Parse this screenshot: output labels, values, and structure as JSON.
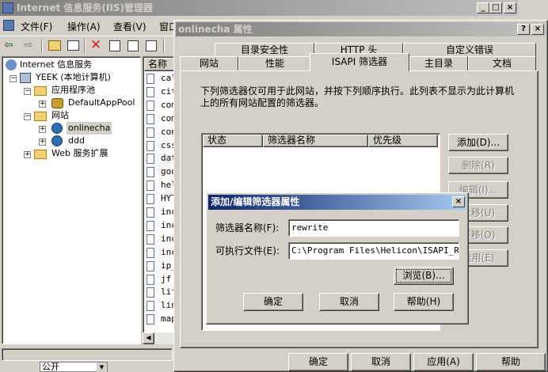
{
  "main_window": {
    "title": "Internet 信息服务(IIS)管理器",
    "menu": [
      "文件(F)",
      "操作(A)",
      "查看(V)",
      "窗口(W)"
    ],
    "tree": [
      {
        "label": "Internet 信息服务"
      },
      {
        "label": "YEEK (本地计算机)"
      },
      {
        "label": "应用程序池"
      },
      {
        "label": "DefaultAppPool"
      },
      {
        "label": "网站"
      },
      {
        "label": "onlinecha"
      },
      {
        "label": "ddd"
      },
      {
        "label": "Web 服务扩展"
      }
    ],
    "list_header": "名称",
    "files": [
      "cal",
      "cit",
      "com",
      "com",
      "con",
      "css",
      "dat",
      "goo",
      "hel",
      "HYT",
      "inc",
      "inc",
      "inc",
      "inc",
      "ip_",
      "jf.",
      "lif",
      "lin",
      "map"
    ],
    "status_text": "公开"
  },
  "properties_dialog": {
    "title": "onlinecha 属性",
    "tabs_row1": [
      "目录安全性",
      "HTTP 头",
      "自定义错误"
    ],
    "tabs_row2": [
      "网站",
      "性能",
      "ISAPI 筛选器",
      "主目录",
      "文档"
    ],
    "description": "下列筛选器仅可用于此网站，并按下列顺序执行。此列表不显示为此计算机上的所有网站配置的筛选器。",
    "columns": [
      "状态",
      "筛选器名称",
      "优先级"
    ],
    "side_buttons": [
      "添加(D)...",
      "删除(R)",
      "编辑(I)...",
      "上移(U)",
      "下移(O)",
      "启用(E)"
    ],
    "bottom_buttons": {
      "ok": "确定",
      "cancel": "取消",
      "apply": "应用(A)",
      "help": "帮助"
    }
  },
  "filter_dialog": {
    "title": "添加/编辑筛选器属性",
    "name_label": "筛选器名称(F):",
    "name_value": "rewrite",
    "exe_label": "可执行文件(E):",
    "exe_value": "C:\\Program Files\\Helicon\\ISAPI_Rewr",
    "browse": "浏览(B)...",
    "ok": "确定",
    "cancel": "取消",
    "help": "帮助(H)"
  }
}
